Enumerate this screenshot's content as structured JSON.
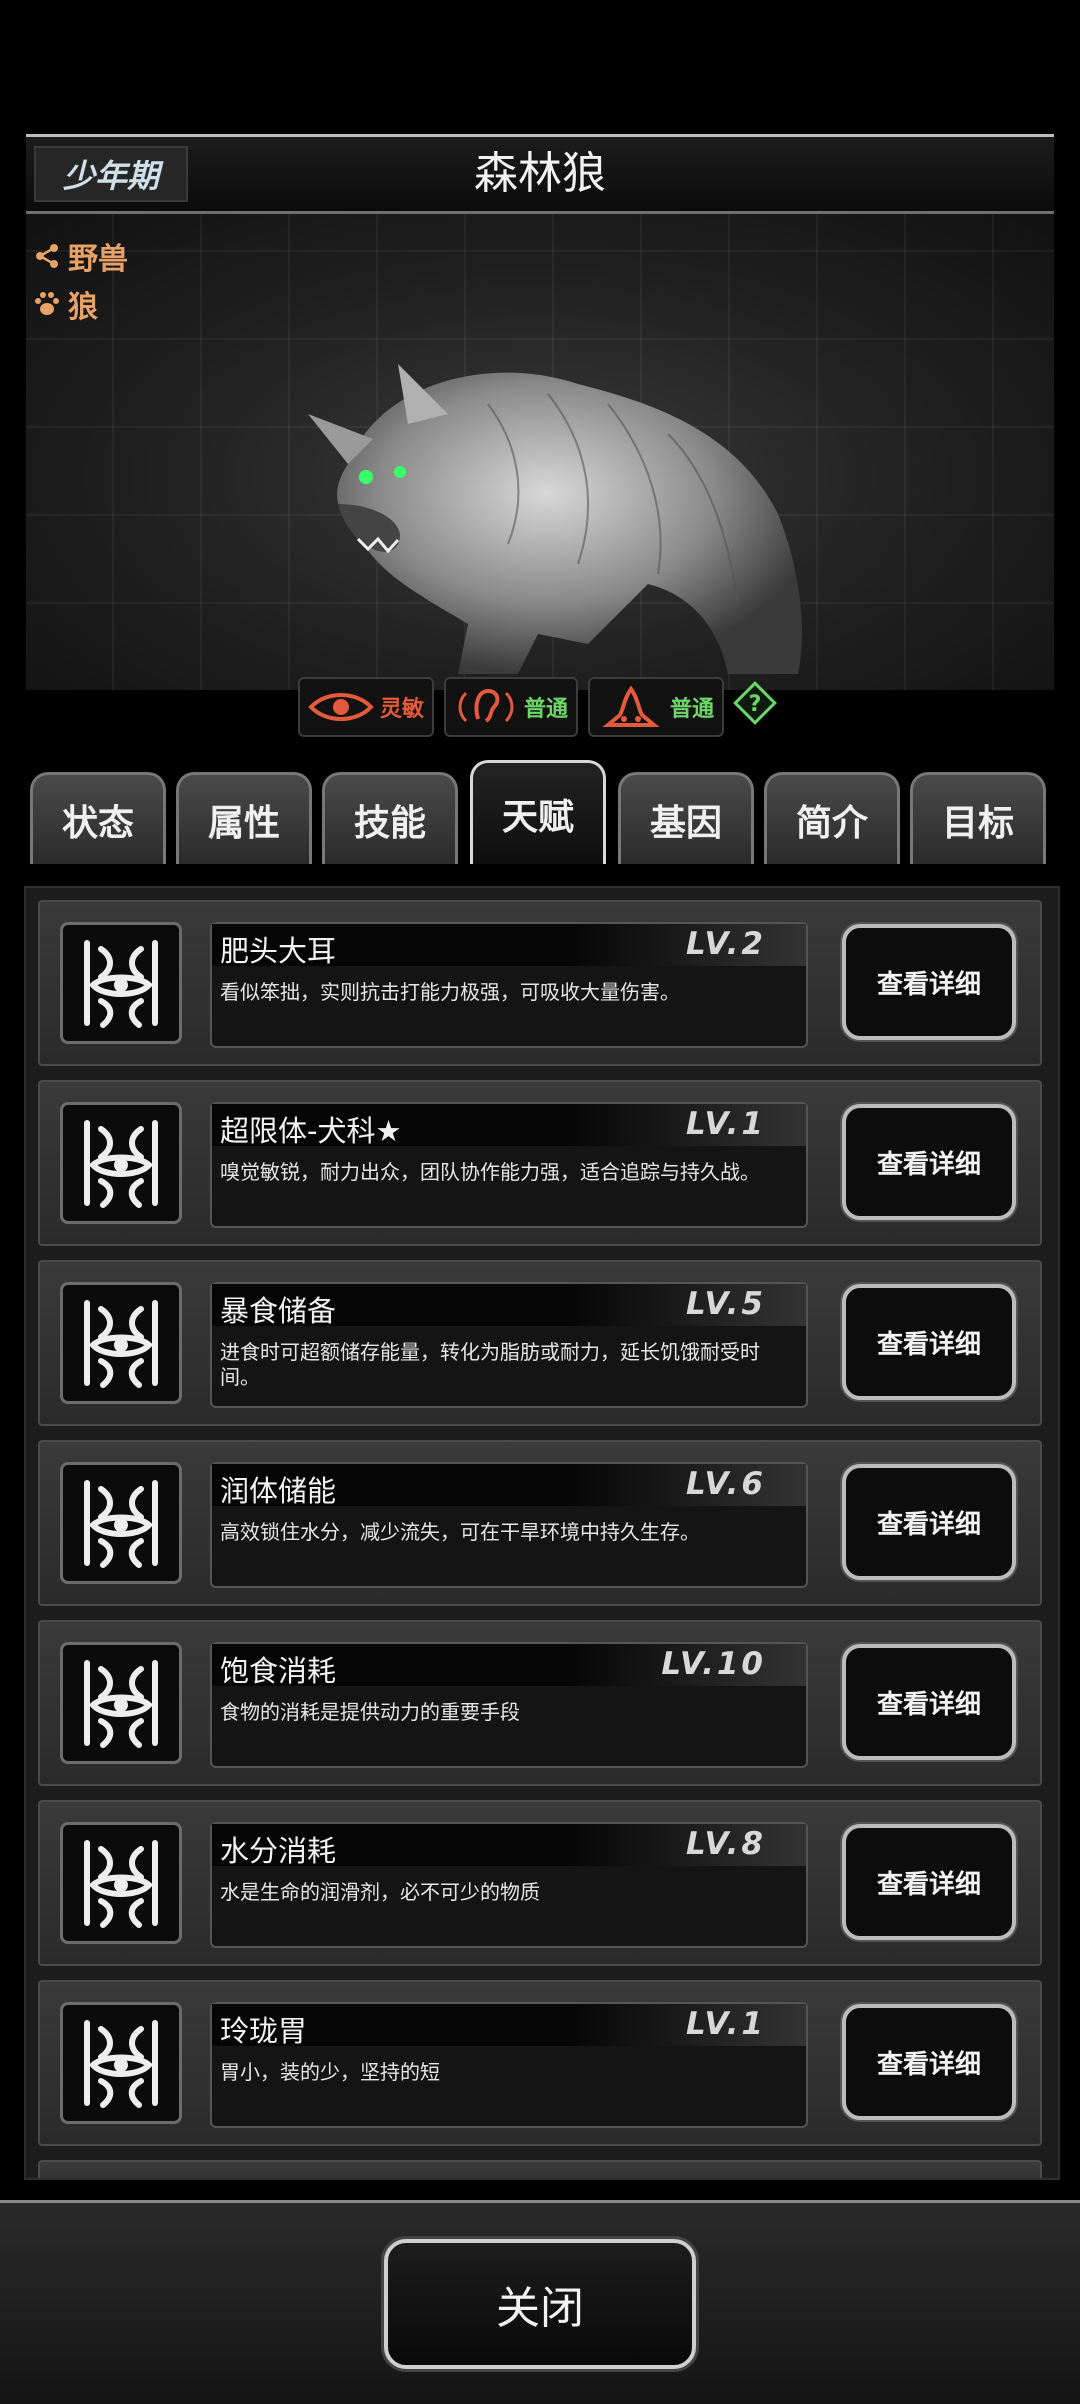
{
  "header": {
    "stage": "少年期",
    "title": "森林狼"
  },
  "creature": {
    "tags": [
      {
        "icon": "share-icon",
        "label": "野兽"
      },
      {
        "icon": "paw-icon",
        "label": "狼"
      }
    ],
    "senses": [
      {
        "icon": "eye-icon",
        "label": "灵敏",
        "color": "#e35a3c"
      },
      {
        "icon": "ear-icon",
        "label": "普通",
        "color": "#6dd66a"
      },
      {
        "icon": "smell-icon",
        "label": "普通",
        "color": "#6dd66a"
      }
    ],
    "help_icon": "question-icon"
  },
  "tabs": [
    "状态",
    "属性",
    "技能",
    "天赋",
    "基因",
    "简介",
    "目标"
  ],
  "active_tab": "天赋",
  "talents": [
    {
      "name": "肥头大耳",
      "level": "LV.2",
      "desc": "看似笨拙，实则抗击打能力极强，可吸收大量伤害。",
      "button": "查看详细"
    },
    {
      "name": "超限体-犬科★",
      "level": "LV.1",
      "desc": "嗅觉敏锐，耐力出众，团队协作能力强，适合追踪与持久战。",
      "button": "查看详细"
    },
    {
      "name": "暴食储备",
      "level": "LV.5",
      "desc": "进食时可超额储存能量，转化为脂肪或耐力，延长饥饿耐受时间。",
      "button": "查看详细"
    },
    {
      "name": "润体储能",
      "level": "LV.6",
      "desc": "高效锁住水分，减少流失，可在干旱环境中持久生存。",
      "button": "查看详细"
    },
    {
      "name": "饱食消耗",
      "level": "LV.10",
      "desc": "食物的消耗是提供动力的重要手段",
      "button": "查看详细"
    },
    {
      "name": "水分消耗",
      "level": "LV.8",
      "desc": "水是生命的润滑剂，必不可少的物质",
      "button": "查看详细"
    },
    {
      "name": "玲珑胃",
      "level": "LV.1",
      "desc": "胃小，装的少，坚持的短",
      "button": "查看详细"
    }
  ],
  "footer": {
    "close_label": "关闭"
  }
}
